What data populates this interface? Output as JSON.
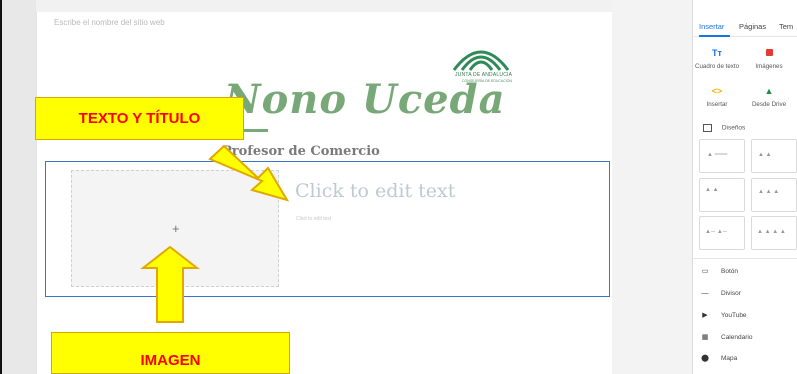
{
  "editor": {
    "site_name_placeholder": "Escribe el nombre del sitio web",
    "logo_text": "JUNTA DE ANDALUCIA",
    "logo_subtext": "CONSEJERÍA DE EDUCACIÓN",
    "header_title": "Nono Uceda",
    "header_subtitle": "Profesor de Comercio",
    "text_placeholder_large": "Click to edit text",
    "text_placeholder_small": "Click to edit text",
    "image_add_symbol": "+"
  },
  "annotations": {
    "texto_titulo": "TEXTO Y TÍTULO",
    "imagen": "IMAGEN"
  },
  "sidebar": {
    "tabs": [
      "Insertar",
      "Páginas",
      "Tem"
    ],
    "active_tab": "Insertar",
    "tools": [
      {
        "label": "Cuadro de texto",
        "icon": "text-box-icon"
      },
      {
        "label": "Imágenes",
        "icon": "image-icon"
      },
      {
        "label": "Insertar",
        "icon": "embed-icon"
      },
      {
        "label": "Desde Drive",
        "icon": "drive-icon"
      }
    ],
    "layouts_header": "Diseños",
    "components": [
      {
        "label": "Botón",
        "icon": "button-icon"
      },
      {
        "label": "Divisor",
        "icon": "divider-icon"
      },
      {
        "label": "YouTube",
        "icon": "youtube-icon"
      },
      {
        "label": "Calendario",
        "icon": "calendar-icon"
      },
      {
        "label": "Mapa",
        "icon": "map-icon"
      }
    ]
  },
  "colors": {
    "accent": "#1a73e8",
    "title_green": "#78a878",
    "callout_yellow": "#ffff00",
    "callout_text": "#ff0000",
    "selection_blue": "#3f73c9"
  }
}
